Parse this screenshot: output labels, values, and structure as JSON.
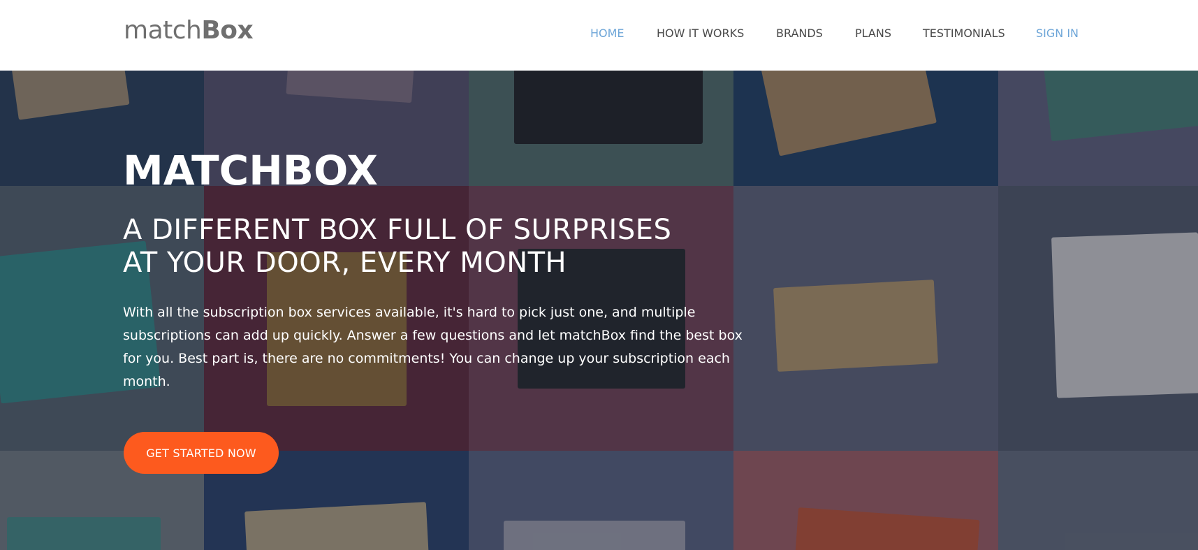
{
  "brand": {
    "light": "match",
    "bold": "Box"
  },
  "nav": {
    "home": "HOME",
    "how_it_works": "HOW IT WORKS",
    "brands": "BRANDS",
    "plans": "PLANS",
    "testimonials": "TESTIMONIALS",
    "sign_in": "SIGN IN"
  },
  "hero": {
    "title_light": "MATCH",
    "title_bold": "BOX",
    "subtitle_line1": "A DIFFERENT BOX FULL OF SURPRISES",
    "subtitle_line2": "AT YOUR DOOR, EVERY MONTH",
    "body": "With all the subscription box services available, it's hard to pick just one, and multiple subscriptions can add up quickly. Answer a few questions and let matchBox find the best box for you. Best part is, there are no commitments! You can change up your subscription each month.",
    "cta": "GET STARTED NOW"
  },
  "colors": {
    "accent": "#fd5a1e",
    "nav_active": "#6ea6d8",
    "logo": "#6f6f6f"
  }
}
